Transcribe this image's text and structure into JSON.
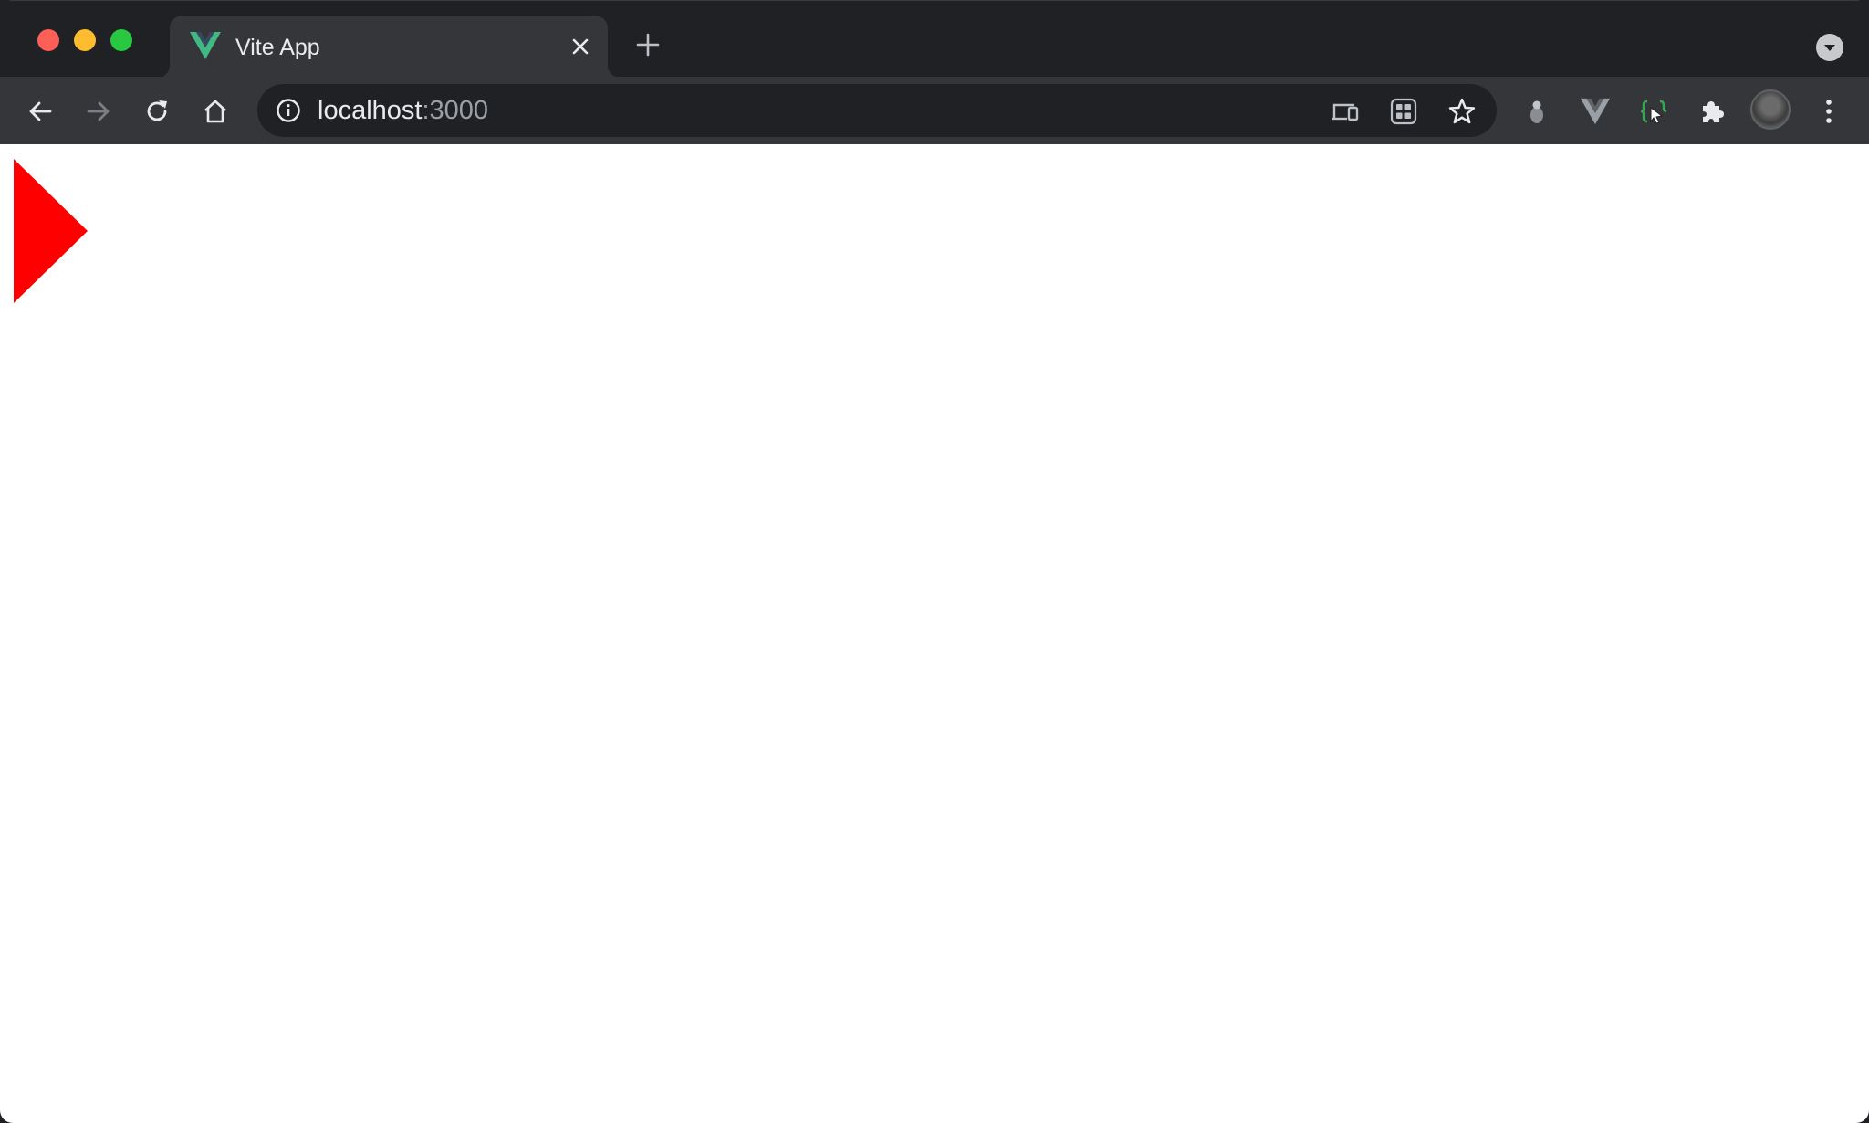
{
  "browser": {
    "tab": {
      "title": "Vite App",
      "favicon": "vue-logo-icon"
    },
    "address": {
      "host": "localhost",
      "port": ":3000"
    },
    "toolbar_icons": [
      "back-arrow-icon",
      "forward-arrow-icon",
      "reload-icon",
      "home-icon"
    ],
    "omnibox_icons": [
      "cast-icon",
      "apps-icon",
      "star-icon"
    ],
    "extension_icons": [
      "lightbulb-extension-icon",
      "vue-devtools-icon",
      "selector-extension-icon",
      "puzzle-extensions-icon",
      "menu-kebab-icon"
    ]
  },
  "colors": {
    "triangle": "#ff0000",
    "vue_green": "#42b883",
    "vue_dark": "#35495e"
  }
}
